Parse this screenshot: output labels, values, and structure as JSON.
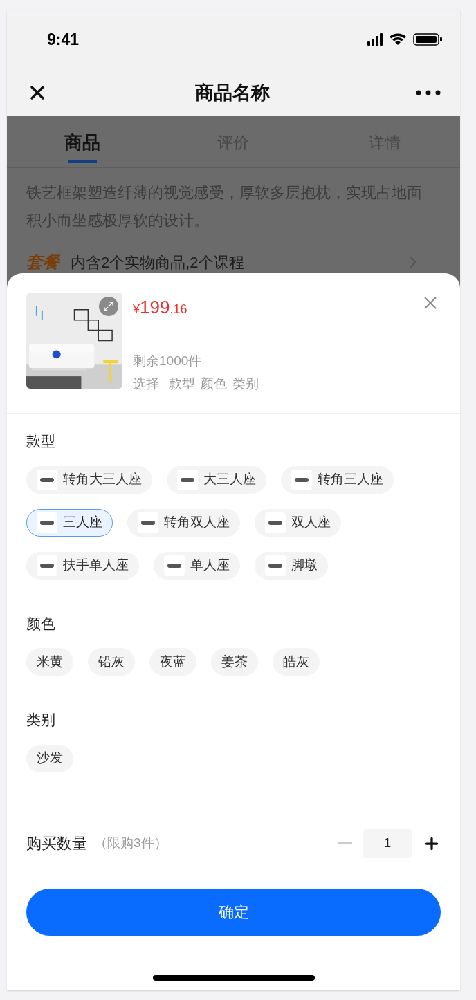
{
  "status_bar": {
    "time": "9:41"
  },
  "nav": {
    "title": "商品名称"
  },
  "tabs": [
    {
      "label": "商品",
      "selected": true
    },
    {
      "label": "评价",
      "selected": false
    },
    {
      "label": "详情",
      "selected": false
    }
  ],
  "background_content": {
    "description": "铁艺框架塑造纤薄的视觉感受，厚软多层抱枕，实现占地面积小而坐感极厚软的设计。",
    "package": {
      "tag": "套餐",
      "text": "内含2个实物商品,2个课程"
    }
  },
  "sheet": {
    "price": {
      "currency": "¥",
      "integer": "199",
      "decimal": ".16"
    },
    "stock": "剩余1000件",
    "selection": {
      "label": "选择",
      "items": [
        "款型",
        "颜色",
        "类别"
      ]
    },
    "groups": [
      {
        "title": "款型",
        "options": [
          {
            "kind": "thumbnail",
            "label": "转角大三人座",
            "selected": false
          },
          {
            "kind": "thumbnail",
            "label": "大三人座",
            "selected": false
          },
          {
            "kind": "thumbnail",
            "label": "转角三人座",
            "selected": false
          },
          {
            "kind": "thumbnail",
            "label": "三人座",
            "selected": true
          },
          {
            "kind": "thumbnail",
            "label": "转角双人座",
            "selected": false
          },
          {
            "kind": "thumbnail",
            "label": "双人座",
            "selected": false
          },
          {
            "kind": "thumbnail",
            "label": "扶手单人座",
            "selected": false
          },
          {
            "kind": "thumbnail",
            "label": "单人座",
            "selected": false
          },
          {
            "kind": "thumbnail",
            "label": "脚墩",
            "selected": false
          }
        ]
      },
      {
        "title": "颜色",
        "options": [
          {
            "kind": "plain",
            "label": "米黄",
            "selected": false
          },
          {
            "kind": "plain",
            "label": "铅灰",
            "selected": false
          },
          {
            "kind": "plain",
            "label": "夜蓝",
            "selected": false
          },
          {
            "kind": "plain",
            "label": "姜茶",
            "selected": false
          },
          {
            "kind": "plain",
            "label": "皓灰",
            "selected": false
          }
        ]
      },
      {
        "title": "类别",
        "options": [
          {
            "kind": "plain",
            "label": "沙发",
            "selected": false
          }
        ]
      }
    ],
    "quantity": {
      "label": "购买数量",
      "limit": "（限购3件）",
      "value": "1",
      "decrement_disabled": true
    },
    "confirm": "确定"
  }
}
